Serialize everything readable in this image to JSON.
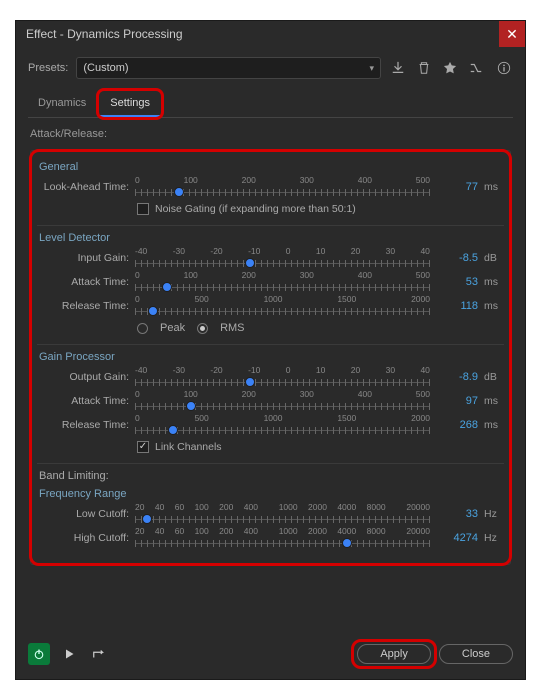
{
  "title": "Effect - Dynamics Processing",
  "presets_label": "Presets:",
  "preset_value": "(Custom)",
  "tabs": {
    "dynamics": "Dynamics",
    "settings": "Settings"
  },
  "subheader": "Attack/Release:",
  "general": {
    "title": "General",
    "look_ahead": {
      "label": "Look-Ahead Time:",
      "ticks": [
        "0",
        "100",
        "200",
        "300",
        "400",
        "500"
      ],
      "value": "77",
      "unit": "ms",
      "pos": 15
    },
    "noise_gating": {
      "label": "Noise Gating (if expanding more than 50:1)",
      "checked": false
    }
  },
  "level_detector": {
    "title": "Level Detector",
    "input_gain": {
      "label": "Input Gain:",
      "ticks": [
        "-40",
        "-30",
        "-20",
        "-10",
        "0",
        "10",
        "20",
        "30",
        "40"
      ],
      "value": "-8.5",
      "unit": "dB",
      "pos": 39
    },
    "attack": {
      "label": "Attack Time:",
      "ticks": [
        "0",
        "100",
        "200",
        "300",
        "400",
        "500"
      ],
      "value": "53",
      "unit": "ms",
      "pos": 11
    },
    "release": {
      "label": "Release Time:",
      "ticks": [
        "0",
        "500",
        "1000",
        "1500",
        "2000"
      ],
      "value": "118",
      "unit": "ms",
      "pos": 6
    },
    "mode": {
      "peak": "Peak",
      "rms": "RMS",
      "selected": "rms"
    }
  },
  "gain_processor": {
    "title": "Gain Processor",
    "output_gain": {
      "label": "Output Gain:",
      "ticks": [
        "-40",
        "-30",
        "-20",
        "-10",
        "0",
        "10",
        "20",
        "30",
        "40"
      ],
      "value": "-8.9",
      "unit": "dB",
      "pos": 39
    },
    "attack": {
      "label": "Attack Time:",
      "ticks": [
        "0",
        "100",
        "200",
        "300",
        "400",
        "500"
      ],
      "value": "97",
      "unit": "ms",
      "pos": 19
    },
    "release": {
      "label": "Release Time:",
      "ticks": [
        "0",
        "500",
        "1000",
        "1500",
        "2000"
      ],
      "value": "268",
      "unit": "ms",
      "pos": 13
    },
    "link_channels": {
      "label": "Link Channels",
      "checked": true
    }
  },
  "band_limiting": {
    "title": "Band Limiting:",
    "freq_title": "Frequency Range",
    "low": {
      "label": "Low Cutoff:",
      "ticks": [
        "20",
        "40",
        "60",
        "100",
        "200",
        "400",
        "",
        "1000",
        "2000",
        "4000",
        "8000",
        "",
        "20000"
      ],
      "value": "33",
      "unit": "Hz",
      "pos": 4
    },
    "high": {
      "label": "High Cutoff:",
      "ticks": [
        "20",
        "40",
        "60",
        "100",
        "200",
        "400",
        "",
        "1000",
        "2000",
        "4000",
        "8000",
        "",
        "20000"
      ],
      "value": "4274",
      "unit": "Hz",
      "pos": 72
    }
  },
  "buttons": {
    "apply": "Apply",
    "close": "Close"
  }
}
